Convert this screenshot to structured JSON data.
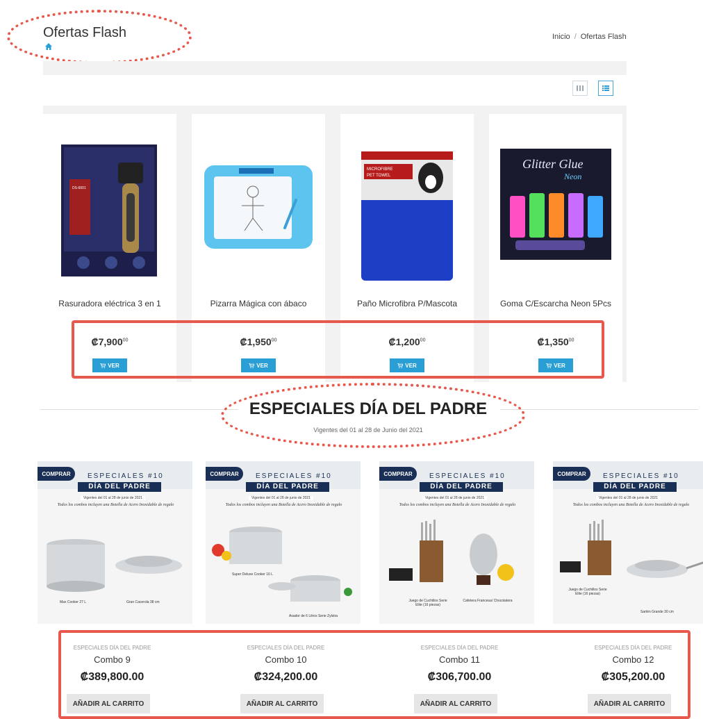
{
  "header": {
    "title": "Ofertas Flash",
    "breadcrumb": {
      "home": "Inicio",
      "separator": "/",
      "current": "Ofertas Flash"
    }
  },
  "flash_products": [
    {
      "name": "Rasuradora eléctrica 3 en 1",
      "price": "₡7,900",
      "cents": "00",
      "button": "VER"
    },
    {
      "name": "Pizarra Mágica con ábaco",
      "price": "₡1,950",
      "cents": "00",
      "button": "VER"
    },
    {
      "name": "Paño Microfibra P/Mascota",
      "price": "₡1,200",
      "cents": "00",
      "button": "VER"
    },
    {
      "name": "Goma C/Escarcha Neon 5Pcs",
      "price": "₡1,350",
      "cents": "00",
      "button": "VER"
    }
  ],
  "product_art": {
    "shaver_box_text": "DS-6001",
    "towel_text_1": "MICROFIBRE",
    "towel_text_2": "PET TOWEL",
    "glue_title": "Glitter Glue",
    "glue_sub": "Neon"
  },
  "special": {
    "title": "ESPECIALES DÍA DEL PADRE",
    "subtitle": "Vigentes del 01 al 28 de Junio del 2021"
  },
  "promo_banner": {
    "badge": "COMPRAR",
    "line1": "ESPECIALES #10",
    "line2": "DÍA DEL PADRE",
    "dates": "Vigentes del 01 al 28 de junio de 2021",
    "note": "Todos los combos incluyen una Botella de Acero Inoxidable de regalo"
  },
  "combos": [
    {
      "category": "ESPECIALES DÍA DEL PADRE",
      "name": "Combo 9",
      "price": "₡389,800.00",
      "button": "AÑADIR AL CARRITO",
      "items": [
        "Max Cooker 27 L",
        "Gran Cacerola 38 cm"
      ]
    },
    {
      "category": "ESPECIALES DÍA DEL PADRE",
      "name": "Combo 10",
      "price": "₡324,200.00",
      "button": "AÑADIR AL CARRITO",
      "items": [
        "Super Deluxe Cooker 16 L",
        "Asador de 6 Litros Serie Zylstra"
      ]
    },
    {
      "category": "ESPECIALES DÍA DEL PADRE",
      "name": "Combo 11",
      "price": "₡306,700.00",
      "button": "AÑADIR AL CARRITO",
      "items": [
        "Juego de Cuchillos Serie Elite (16 piezas)",
        "Cafetera Francesa/ Chocolatera"
      ]
    },
    {
      "category": "ESPECIALES DÍA DEL PADRE",
      "name": "Combo 12",
      "price": "₡305,200.00",
      "button": "AÑADIR AL CARRITO",
      "items": [
        "Juego de Cuchillos Serie Elite (16 piezas)",
        "Sartén Grande 30 cm"
      ]
    }
  ],
  "colors": {
    "accent": "#2a9fd6",
    "annotation": "#e8584c",
    "navy": "#1a2f55"
  },
  "icons": [
    "home-icon",
    "grid-view-icon",
    "list-view-icon",
    "cart-icon"
  ]
}
